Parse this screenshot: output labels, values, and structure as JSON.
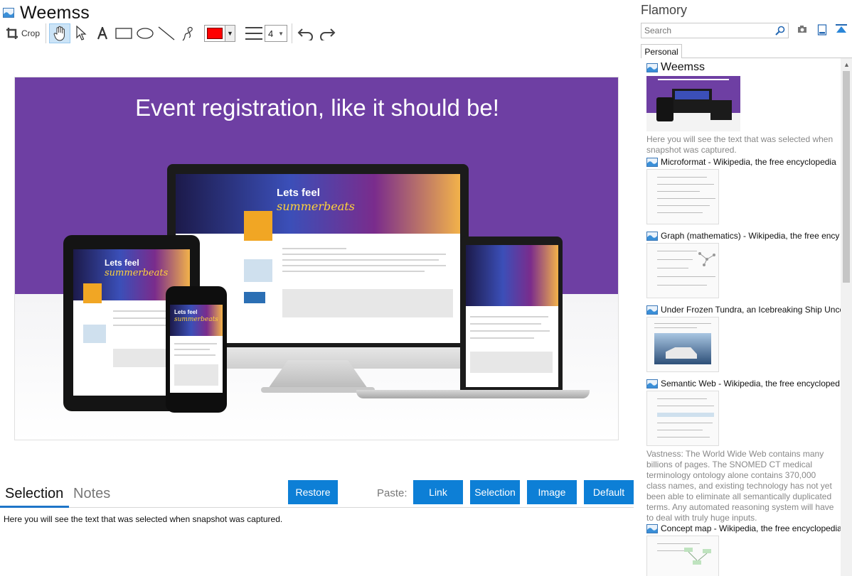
{
  "window": {
    "title": "Weemss"
  },
  "toolbar": {
    "crop_label": "Crop",
    "line_width": "4",
    "active_color": "#ff0000"
  },
  "snapshot": {
    "banner_text": "Event registration, like it should be!",
    "hero_line1": "Lets feel",
    "hero_line2": "summerbeats"
  },
  "tabs": {
    "selection": "Selection",
    "notes": "Notes"
  },
  "buttons": {
    "restore": "Restore",
    "paste_label": "Paste:",
    "link": "Link",
    "selection": "Selection",
    "image": "Image",
    "default": "Default"
  },
  "selection_text": "Here you will see the text that was selected when snapshot was captured.",
  "sidebar": {
    "title": "Flamory",
    "search_placeholder": "Search",
    "tab": "Personal",
    "items": [
      {
        "title": "Weemss",
        "desc": "Here you will see the text that was selected when snapshot was captured."
      },
      {
        "title": "Microformat - Wikipedia, the free encyclopedia"
      },
      {
        "title": "Graph (mathematics) - Wikipedia, the free ency"
      },
      {
        "title": "Under Frozen Tundra, an Icebreaking Ship Unco"
      },
      {
        "title": "Semantic Web - Wikipedia, the free encycloped",
        "desc": "Vastness: The World Wide Web contains many billions of pages. The SNOMED CT medical terminology ontology alone contains 370,000 class names, and existing technology has not yet been able to eliminate all semantically duplicated terms. Any automated reasoning system will have to deal with truly huge inputs."
      },
      {
        "title": "Concept map - Wikipedia, the free encyclopedia"
      }
    ]
  },
  "colors": {
    "accent": "#0d7fd6",
    "banner": "#6e3fa3"
  }
}
